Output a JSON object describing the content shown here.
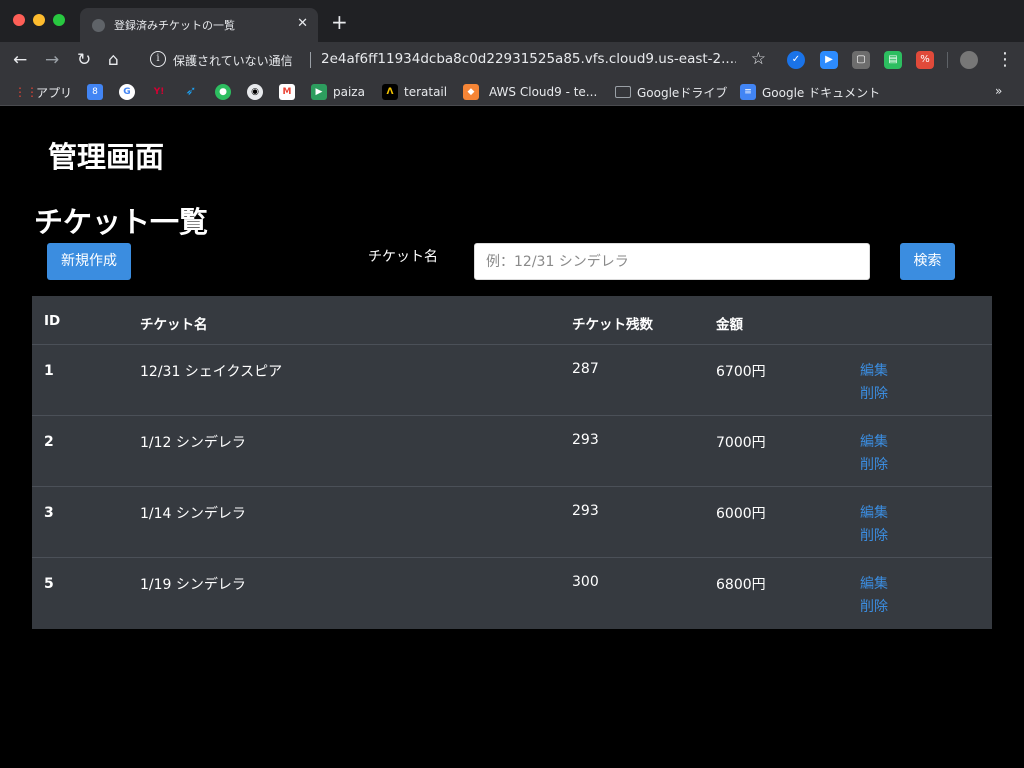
{
  "browser": {
    "tab_title": "登録済みチケットの一覧",
    "tab_close": "✕",
    "new_tab": "+",
    "security_text": "保護されていない通信",
    "url": "2e4af6ff11934dcba8c0d22931525a85.vfs.cloud9.us-east-2....",
    "bookmarks": [
      {
        "label": "アプリ",
        "icon": "apps-grid-icon",
        "color": "#4285f4"
      },
      {
        "label": "",
        "icon": "google-calendar-icon",
        "color": "#4285f4"
      },
      {
        "label": "",
        "icon": "google-icon",
        "color": "#ffffff"
      },
      {
        "label": "",
        "icon": "yahoo-icon",
        "color": "#d50032"
      },
      {
        "label": "",
        "icon": "twitter-icon",
        "color": "#1da1f2"
      },
      {
        "label": "",
        "icon": "evernote-icon",
        "color": "#2dbe60"
      },
      {
        "label": "",
        "icon": "github-icon",
        "color": "#ffffff"
      },
      {
        "label": "",
        "icon": "gmail-icon",
        "color": "#ea4335"
      },
      {
        "label": "paiza",
        "icon": "paiza-icon",
        "color": "#2d9d5e"
      },
      {
        "label": "teratail",
        "icon": "teratail-icon",
        "color": "#000000"
      },
      {
        "label": "AWS Cloud9 - te...",
        "icon": "aws-cloud9-icon",
        "color": "#f58536"
      },
      {
        "label": "Googleドライブ",
        "icon": "folder-icon",
        "color": "#9aa0a6"
      },
      {
        "label": "Google ドキュメント",
        "icon": "google-docs-icon",
        "color": "#4285f4"
      }
    ],
    "bookmarks_more": "»"
  },
  "page": {
    "site_title": "管理画面",
    "section_title": "チケット一覧",
    "new_button": "新規作成",
    "search_label": "チケット名",
    "search_placeholder": "例：12/31 シンデレラ",
    "search_button": "検索"
  },
  "table": {
    "headers": [
      "ID",
      "チケット名",
      "チケット残数",
      "金額"
    ],
    "edit_label": "編集",
    "delete_label": "削除",
    "rows": [
      {
        "id": "1",
        "name": "12/31 シェイクスピア",
        "remaining": "287",
        "price": "6700円"
      },
      {
        "id": "2",
        "name": "1/12 シンデレラ",
        "remaining": "293",
        "price": "7000円"
      },
      {
        "id": "3",
        "name": "1/14 シンデレラ",
        "remaining": "293",
        "price": "6000円"
      },
      {
        "id": "5",
        "name": "1/19 シンデレラ",
        "remaining": "300",
        "price": "6800円"
      }
    ]
  },
  "colors": {
    "accent": "#3b8de0",
    "table_bg": "#363a40",
    "page_bg": "#000000"
  }
}
